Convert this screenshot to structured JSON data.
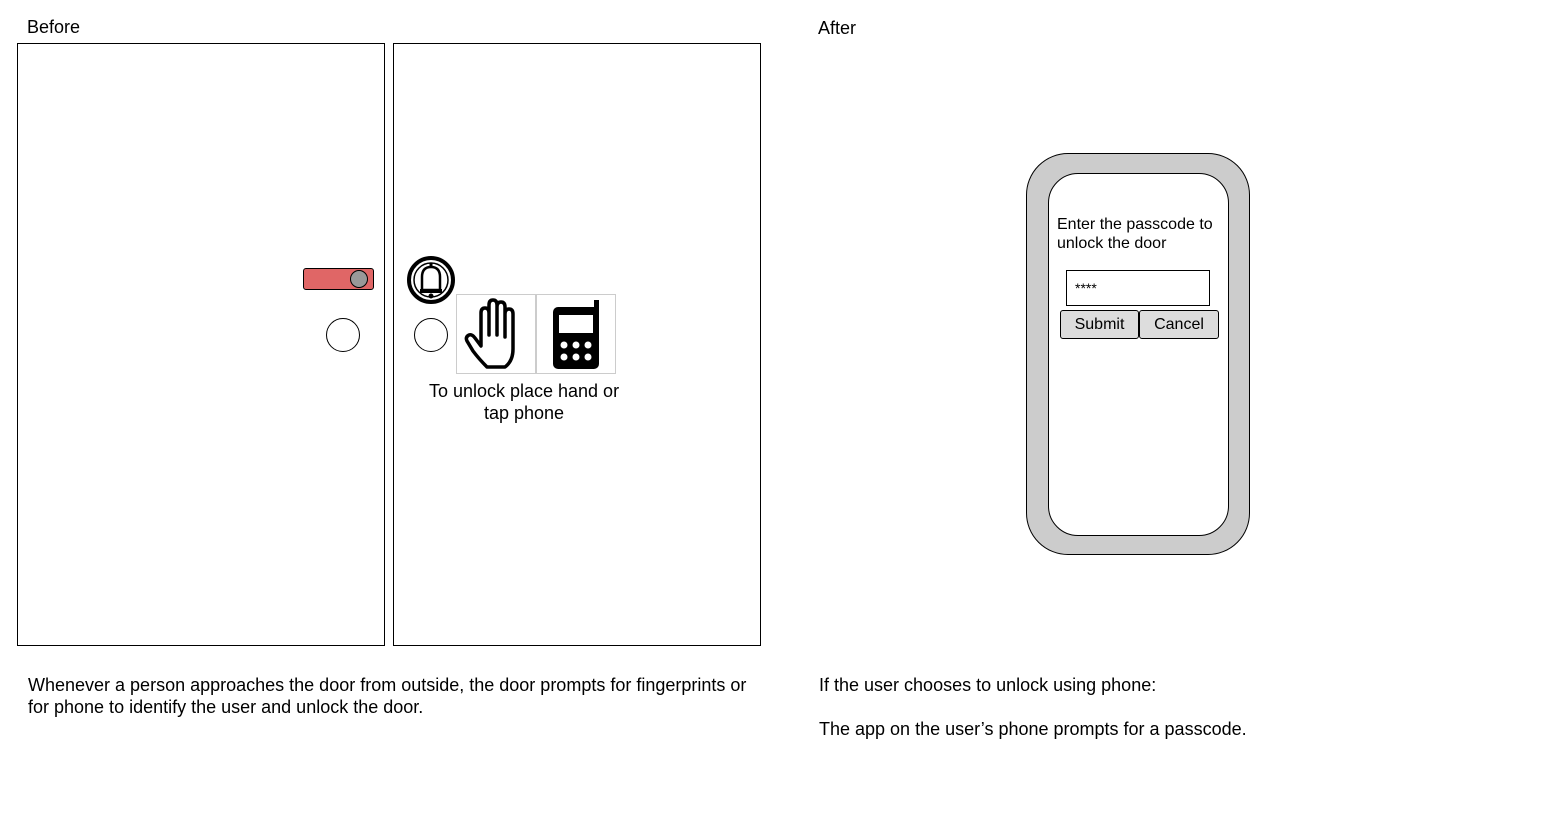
{
  "before": {
    "label": "Before",
    "unlock_caption": "To unlock place hand or tap phone",
    "description": "Whenever a person approaches the door from outside, the door prompts for fingerprints or for phone to identify the user and unlock the door."
  },
  "after": {
    "label": "After",
    "description_line1": "If the user chooses to unlock using phone:",
    "description_line2": "The app on the user’s phone prompts for a passcode.",
    "phone": {
      "prompt": "Enter the passcode to unlock the door",
      "passcode_value": "****",
      "submit_label": "Submit",
      "cancel_label": "Cancel"
    }
  },
  "colors": {
    "lock_toggle": "#e06666",
    "phone_frame": "#cccccc",
    "button": "#dddddd"
  }
}
